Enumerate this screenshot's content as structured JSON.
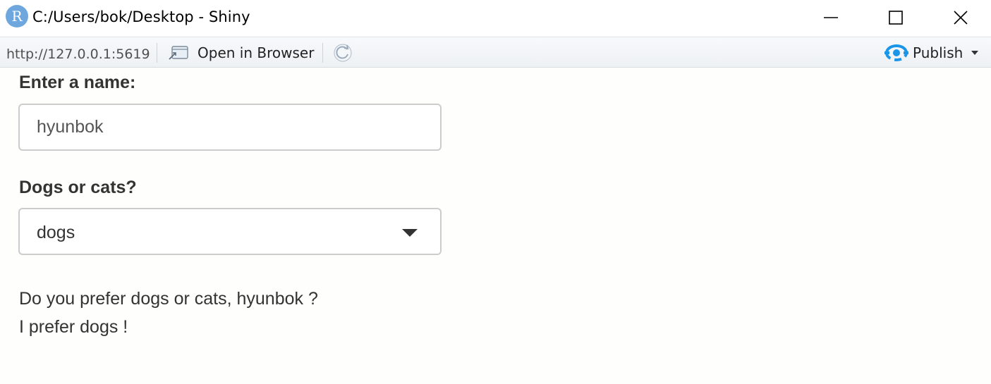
{
  "window": {
    "app_icon_letter": "R",
    "title": "C:/Users/bok/Desktop - Shiny",
    "minimize_icon": "minimize-icon",
    "maximize_icon": "maximize-icon",
    "close_icon": "close-icon"
  },
  "toolbar": {
    "url": "http://127.0.0.1:5619",
    "open_browser_label": "Open in Browser",
    "refresh_icon": "refresh-icon",
    "publish_label": "Publish",
    "publish_icon_color": "#1a95e8"
  },
  "form": {
    "name_label": "Enter a name:",
    "name_value": "hyunbok",
    "pet_label": "Dogs or cats?",
    "pet_selected": "dogs"
  },
  "output": {
    "line1": "Do you prefer dogs or cats, hyunbok ?",
    "line2": "I prefer dogs !"
  }
}
